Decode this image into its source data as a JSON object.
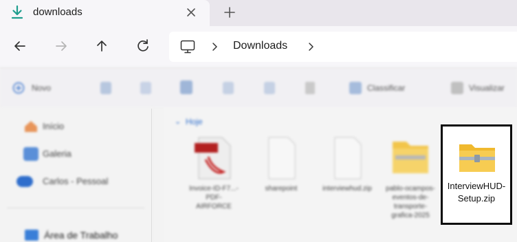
{
  "tab": {
    "title": "downloads",
    "close_label": "×",
    "new_tab_label": "+"
  },
  "address": {
    "location": "Downloads"
  },
  "toolbar": {
    "new_label": "Novo",
    "sort_label": "Classificar",
    "view_label": "Visualizar"
  },
  "sidebar": {
    "items": [
      {
        "label": "Início",
        "icon": "home-icon"
      },
      {
        "label": "Galeria",
        "icon": "gallery-icon"
      },
      {
        "label": "Carlos - Pessoal",
        "icon": "cloud-icon"
      },
      {
        "label": "Área de Trabalho",
        "icon": "desktop-icon"
      }
    ]
  },
  "content": {
    "section_header": "Hoje",
    "files": [
      {
        "label": "Invoice-ID-F7...-PDF-AIRFORCE",
        "icon": "pdf-icon"
      },
      {
        "label": "sharepoint",
        "icon": "document-icon"
      },
      {
        "label": "interviewhud.zip",
        "icon": "document-icon"
      },
      {
        "label": "pablo-ocampos-eventos-de-transporte-grafica-2025",
        "icon": "zip-folder-icon"
      }
    ],
    "selected_file": {
      "label": "InterviewHUD-Setup.zip",
      "icon": "zip-folder-icon"
    }
  }
}
